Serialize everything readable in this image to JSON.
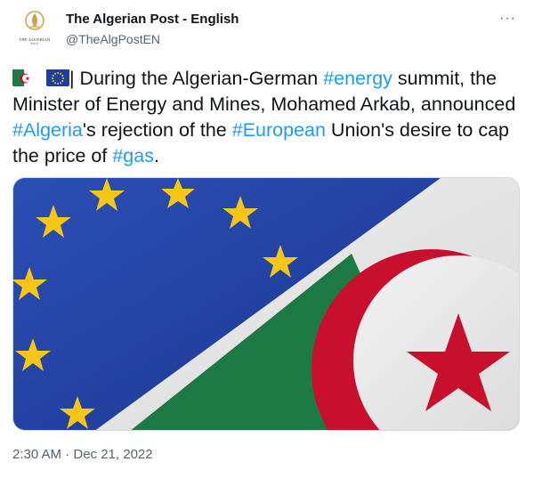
{
  "account": {
    "display_name": "The Algerian Post - English",
    "handle": "@TheAlgPostEN",
    "avatar_text": "THE ALGERIAN",
    "avatar_subtext": "POST"
  },
  "tweet": {
    "parts": [
      {
        "text": "| During the Algerian-German ",
        "hashtag": false
      },
      {
        "text": "#energy",
        "hashtag": true
      },
      {
        "text": " summit, the Minister of Energy and Mines, Mohamed Arkab, announced ",
        "hashtag": false
      },
      {
        "text": "#Algeria",
        "hashtag": true
      },
      {
        "text": "'s rejection of the ",
        "hashtag": false
      },
      {
        "text": "#European",
        "hashtag": true
      },
      {
        "text": " Union's desire to cap the price of ",
        "hashtag": false
      },
      {
        "text": "#gas",
        "hashtag": true
      },
      {
        "text": ".",
        "hashtag": false
      }
    ],
    "leading_icons": [
      "algeria-flag-icon",
      "eu-flag-icon"
    ],
    "timestamp": "2:30 AM · Dec 21, 2022"
  },
  "ui": {
    "more_icon": "more-options-icon",
    "more_glyph": "···"
  },
  "colors": {
    "hashtag": "#1d9bf0",
    "secondary_text": "#536471",
    "eu_blue": "#1f3fa0",
    "eu_star": "#f5c518",
    "algeria_green": "#1e7a45",
    "algeria_red": "#c8102e"
  }
}
